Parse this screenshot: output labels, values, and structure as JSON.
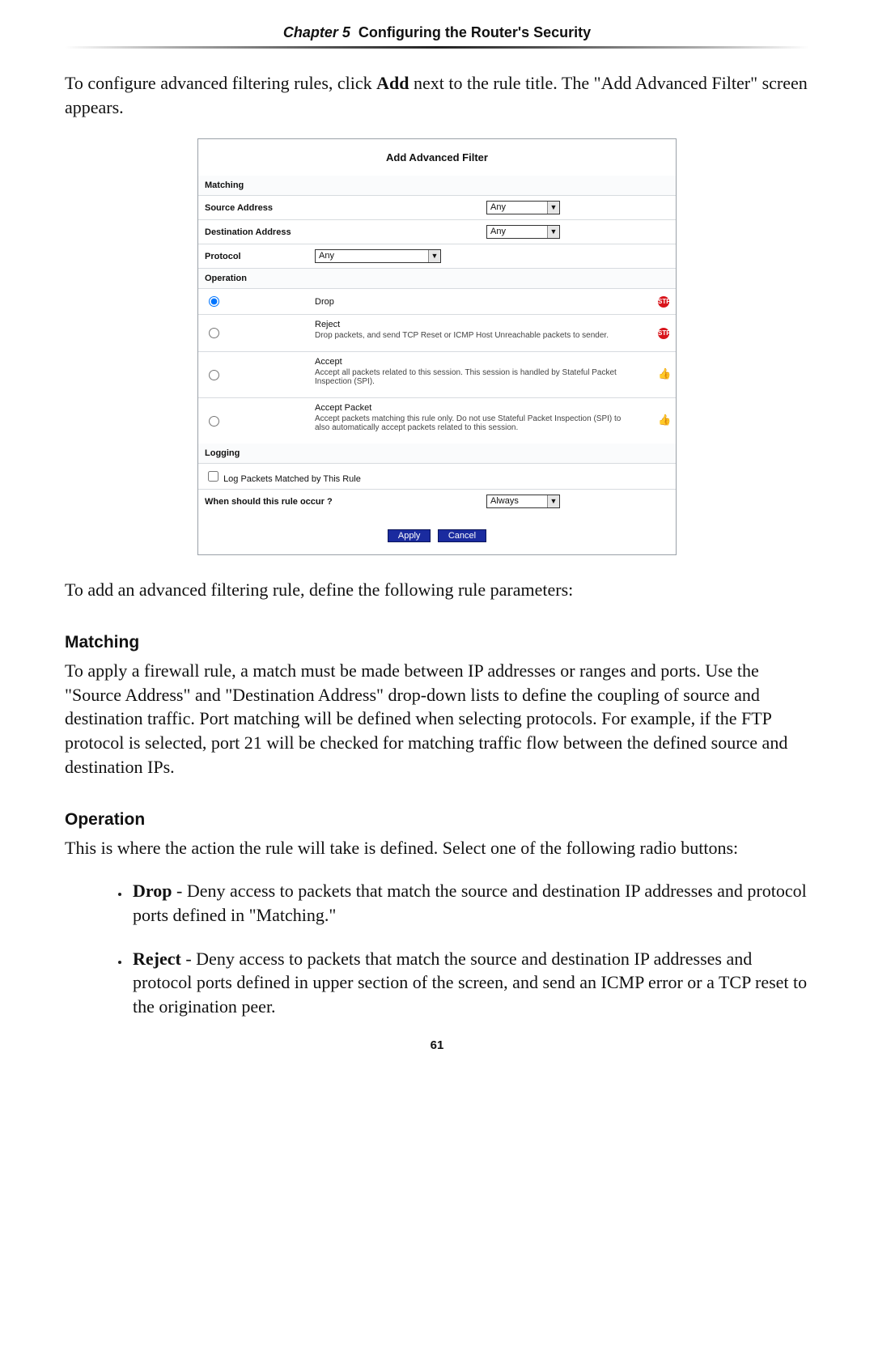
{
  "header": {
    "chapter_label": "Chapter 5",
    "chapter_title": "Configuring the Router's Security"
  },
  "intro_para": "To configure advanced filtering rules, click Add next to the rule title. The \"Add Advanced Filter\" screen appears.",
  "screenshot": {
    "title": "Add Advanced Filter",
    "matching_header": "Matching",
    "src_addr_label": "Source Address",
    "src_addr_value": "Any",
    "dst_addr_label": "Destination Address",
    "dst_addr_value": "Any",
    "protocol_label": "Protocol",
    "protocol_value": "Any",
    "operation_header": "Operation",
    "op_drop_label": "Drop",
    "op_reject_label": "Reject",
    "op_reject_desc": "Drop packets, and send TCP Reset or ICMP Host Unreachable packets to sender.",
    "op_accept_label": "Accept",
    "op_accept_desc": "Accept all packets related to this session. This session is handled by Stateful Packet Inspection (SPI).",
    "op_accept_packet_label": "Accept Packet",
    "op_accept_packet_desc": "Accept packets matching this rule only. Do not use Stateful Packet Inspection (SPI) to also automatically accept packets related to this session.",
    "logging_header": "Logging",
    "log_checkbox_label": "Log Packets Matched by This Rule",
    "schedule_label": "When should this rule occur ?",
    "schedule_value": "Always",
    "btn_apply": "Apply",
    "btn_cancel": "Cancel"
  },
  "after_screenshot_para": "To add an advanced filtering rule, define the following rule parameters:",
  "matching": {
    "heading": "Matching",
    "para": "To apply a firewall rule, a match must be made between IP addresses or ranges and ports. Use the \"Source Address\" and \"Destination Address\" drop-down lists to define the coupling of source and destination traffic. Port matching will be defined when selecting protocols. For example, if the FTP protocol is selected, port 21 will be checked for matching traffic flow between the defined source and destination IPs."
  },
  "operation": {
    "heading": "Operation",
    "intro": "This is where the action the rule will take is defined. Select one of the following radio buttons:",
    "drop_label": "Drop",
    "drop_desc": " - Deny access to packets that match the source and destination IP addresses and protocol ports defined in \"Matching.\"",
    "reject_label": "Reject",
    "reject_desc": " - Deny access to packets that match the source and destination IP addresses and protocol ports defined in upper section of the screen, and send an ICMP error or a TCP reset to the origination peer."
  },
  "page_number": "61"
}
